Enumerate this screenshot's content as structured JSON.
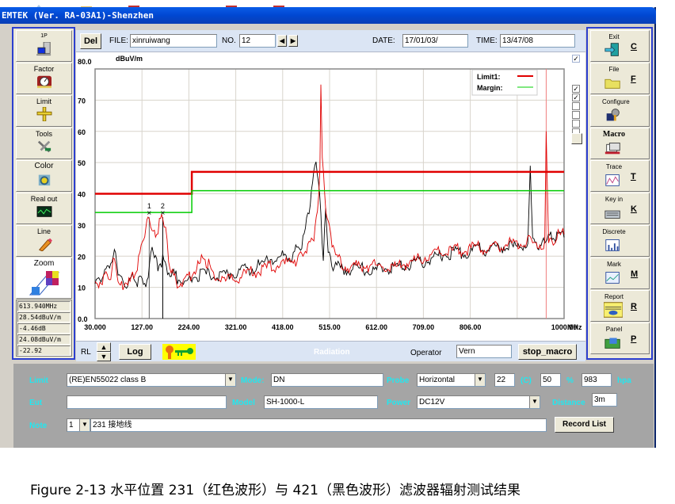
{
  "window": {
    "title": "EMTEK (Ver. RA-03A1)-Shenzhen"
  },
  "left_toolbar": {
    "items": [
      {
        "label": "1P",
        "icon": "computer-icon"
      },
      {
        "label": "Factor",
        "icon": "gauge-icon"
      },
      {
        "label": "Limit",
        "icon": "ruler-icon"
      },
      {
        "label": "Tools",
        "icon": "tools-icon"
      },
      {
        "label": "Color",
        "icon": "color-bulb-icon"
      },
      {
        "label": "Real out",
        "icon": "oscilloscope-icon"
      },
      {
        "label": "Line",
        "icon": "pencil-icon"
      },
      {
        "label": "Zoom",
        "icon": "zoom-grid-icon"
      }
    ],
    "readouts": [
      "613.940MHz",
      "28.54dBuV/m",
      "-4.46dB",
      "24.08dBuV/m",
      "-22.92"
    ]
  },
  "right_toolbar": {
    "items": [
      {
        "label": "Exit",
        "key": "C",
        "icon": "exit-door-icon"
      },
      {
        "label": "File",
        "key": "F",
        "icon": "folder-icon"
      },
      {
        "label": "Configure",
        "key": "",
        "icon": "configure-icon"
      },
      {
        "label": "Macro",
        "key": "",
        "icon": "macro-icon"
      },
      {
        "label": "Trace",
        "key": "T",
        "icon": "trace-icon"
      },
      {
        "label": "Key in",
        "key": "K",
        "icon": "keyboard-icon"
      },
      {
        "label": "Discrete",
        "key": "",
        "icon": "discrete-bars-icon"
      },
      {
        "label": "Mark",
        "key": "M",
        "icon": "mark-chart-icon"
      },
      {
        "label": "Report",
        "key": "R",
        "icon": "report-icon"
      },
      {
        "label": "Panel",
        "key": "P",
        "icon": "panel-icon"
      }
    ]
  },
  "header": {
    "del_label": "Del",
    "file_label": "FILE:",
    "file_value": "xinruiwang",
    "no_label": "NO.",
    "no_value": "12",
    "date_label": "DATE:",
    "date_value": "17/01/03/",
    "time_label": "TIME:",
    "time_value": "13/47/08"
  },
  "trace_checkboxes": [
    true,
    true,
    true,
    false,
    false,
    false,
    false
  ],
  "footer_bar": {
    "rl_label": "RL",
    "log_label": "Log",
    "mode_text": "Radiation",
    "operator_label": "Operator",
    "operator_value": "Vern",
    "stop_macro_label": "stop_macro"
  },
  "settings_panel": {
    "limit_label": "Limit",
    "limit_value": "(RE)EN55022 class B",
    "mode_label": "Mode:",
    "mode_value": "DN",
    "probe_label": "Probe",
    "probe_value": "Horizontal",
    "temperature_value": "22",
    "temperature_unit": "(C)",
    "humidity_value": "50",
    "humidity_unit": "%",
    "pressure_value": "983",
    "pressure_unit": "hpa",
    "eut_label": "Eut",
    "eut_value": "",
    "model_label": "Model",
    "model_value": "SH-1000-L",
    "power_label": "Power",
    "power_value": "DC12V",
    "distance_label": "Distance",
    "distance_value": "3m",
    "note_label": "Note",
    "note_index": "1",
    "note_value": "231 接地线",
    "record_list_label": "Record List"
  },
  "caption": "Figure 2-13  水平位置 231（红色波形）与 421（黑色波形）滤波器辐射测试结果",
  "chart_data": {
    "type": "line",
    "title": "",
    "ylabel": "dBuV/m",
    "xlabel": "MHz",
    "ylim": [
      0,
      80
    ],
    "xlim": [
      30,
      1000
    ],
    "y_ticks": [
      "0.0",
      "10",
      "20",
      "30",
      "40",
      "50",
      "60",
      "70",
      "80.0"
    ],
    "x_ticks": [
      "30.000",
      "127.00",
      "224.00",
      "321.00",
      "418.00",
      "515.00",
      "612.00",
      "709.00",
      "806.00",
      "1000.00"
    ],
    "grid": true,
    "legend": {
      "position": "top-right",
      "entries": [
        {
          "name": "Limit1:",
          "color": "#e00000"
        },
        {
          "name": "Margin:",
          "color": "#00d000"
        }
      ]
    },
    "markers": [
      {
        "label": "1",
        "x": 142,
        "y": 33.5
      },
      {
        "label": "2",
        "x": 170,
        "y": 33.5
      }
    ],
    "series": [
      {
        "name": "Limit1",
        "color": "#e00000",
        "step": true,
        "x": [
          30,
          230,
          230,
          1000
        ],
        "y": [
          40,
          40,
          47,
          47
        ]
      },
      {
        "name": "Margin",
        "color": "#00cc00",
        "step": true,
        "x": [
          30,
          230,
          230,
          1000
        ],
        "y": [
          34,
          34,
          41,
          41
        ]
      },
      {
        "name": "Position 421 (black)",
        "color": "#000000",
        "x": [
          30,
          40,
          50,
          60,
          70,
          75,
          80,
          90,
          100,
          110,
          120,
          130,
          140,
          148,
          155,
          160,
          170,
          180,
          190,
          200,
          215,
          230,
          250,
          270,
          290,
          310,
          330,
          350,
          370,
          390,
          410,
          420,
          440,
          450,
          460,
          470,
          480,
          487,
          492,
          497,
          502,
          507,
          512,
          517,
          525,
          540,
          560,
          580,
          600,
          620,
          640,
          660,
          680,
          700,
          720,
          740,
          760,
          780,
          800,
          820,
          840,
          860,
          880,
          900,
          920,
          925,
          930,
          935,
          945,
          955,
          960,
          965,
          975,
          990,
          1000
        ],
        "y": [
          10,
          13,
          15,
          17,
          22,
          18,
          12,
          11,
          12,
          13,
          12,
          11,
          13,
          24,
          20,
          17,
          19,
          16,
          14,
          13,
          11,
          13,
          14,
          14,
          13,
          15,
          15,
          16,
          17,
          19,
          19,
          21,
          20,
          23,
          25,
          33,
          44,
          49,
          45,
          33,
          20,
          34,
          22,
          18,
          17,
          16,
          16,
          16,
          15,
          16,
          16,
          17,
          17,
          18,
          19,
          20,
          21,
          21,
          21,
          22,
          22,
          23,
          23,
          23,
          24,
          24,
          49,
          24,
          24,
          24,
          25,
          25,
          26,
          26,
          26
        ]
      },
      {
        "name": "Position 231 (red)",
        "color": "#e00000",
        "x": [
          30,
          40,
          50,
          60,
          70,
          75,
          80,
          90,
          100,
          110,
          120,
          128,
          135,
          142,
          148,
          155,
          163,
          170,
          176,
          182,
          190,
          200,
          215,
          230,
          245,
          255,
          265,
          280,
          300,
          320,
          340,
          360,
          380,
          400,
          420,
          440,
          450,
          460,
          470,
          480,
          485,
          490,
          495,
          497,
          500,
          505,
          510,
          520,
          530,
          540,
          560,
          580,
          600,
          620,
          640,
          660,
          680,
          700,
          720,
          740,
          760,
          780,
          800,
          820,
          840,
          860,
          880,
          900,
          920,
          940,
          955,
          960,
          963,
          968,
          980,
          1000
        ],
        "y": [
          10,
          12,
          14,
          13,
          19,
          15,
          9,
          12,
          11,
          14,
          18,
          26,
          29,
          34,
          28,
          27,
          30,
          34,
          28,
          19,
          14,
          11,
          12,
          14,
          17,
          20,
          17,
          13,
          12,
          13,
          14,
          15,
          16,
          17,
          17,
          19,
          18,
          21,
          23,
          26,
          28,
          35,
          48,
          75,
          50,
          40,
          31,
          25,
          20,
          17,
          16,
          17,
          17,
          17,
          16,
          17,
          18,
          19,
          20,
          21,
          21,
          22,
          22,
          23,
          22,
          23,
          24,
          24,
          25,
          24,
          24,
          25,
          60,
          24,
          26,
          27
        ]
      }
    ]
  }
}
